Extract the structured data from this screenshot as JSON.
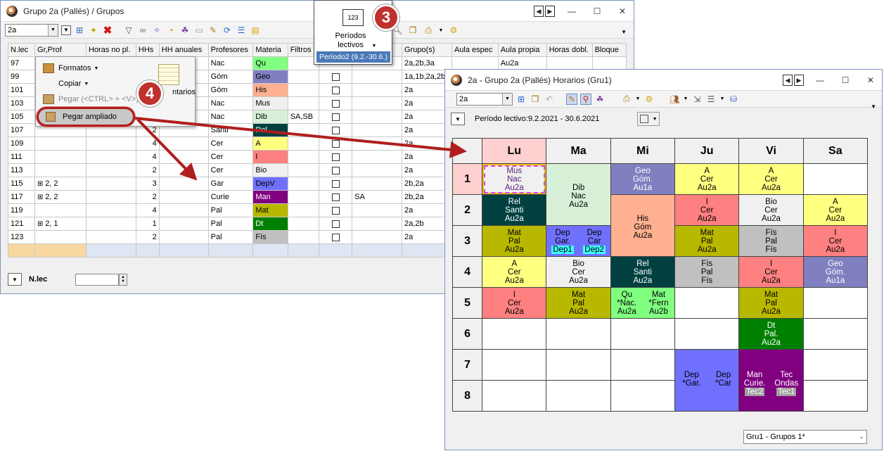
{
  "left_window": {
    "title": "Grupo 2a (Pallés) / Grupos",
    "class_select": "2a",
    "columns": [
      "N.lec",
      "Gr,Prof",
      "Horas no pl.",
      "HHs",
      "HH anuales",
      "Profesores",
      "Materia",
      "Filtros",
      "",
      "",
      "Grupo(s)",
      "Aula espec",
      "Aula propia",
      "Horas dobl.",
      "Bloque"
    ],
    "rows": [
      {
        "nlec": "97",
        "grprof": "",
        "hhs": "",
        "prof": "Nac",
        "mat": "Qu",
        "matcolor": "#80ff80",
        "filtros": "",
        "chk": false,
        "col10": "",
        "grupos": "2a,2b,3a",
        "aulaprop": "Au2a"
      },
      {
        "nlec": "99",
        "grprof": "",
        "hhs": "",
        "prof": "Góm",
        "mat": "Geo",
        "matcolor": "#8080c0",
        "filtros": "",
        "chk": true,
        "col10": "",
        "grupos": "1a,1b,2a,2b",
        "aulaprop": ""
      },
      {
        "nlec": "101",
        "grprof": "",
        "hhs": "",
        "prof": "Góm",
        "mat": "His",
        "matcolor": "#ffb090",
        "filtros": "",
        "chk": true,
        "col10": "",
        "grupos": "2a",
        "aulaprop": ""
      },
      {
        "nlec": "103",
        "grprof": "",
        "hhs": "",
        "prof": "Nac",
        "mat": "Mus",
        "matcolor": "#f0f0f0",
        "filtros": "",
        "chk": true,
        "col10": "",
        "grupos": "2a",
        "aulaprop": ""
      },
      {
        "nlec": "105",
        "grprof": "",
        "hhs": "",
        "prof": "Nac",
        "mat": "Dib",
        "matcolor": "#d8f0d8",
        "filtros": "SA,SB",
        "chk": true,
        "col10": "",
        "grupos": "2a",
        "aulaprop": ""
      },
      {
        "nlec": "107",
        "grprof": "",
        "hhs": "2",
        "prof": "Santi",
        "mat": "Rel",
        "matcolor": "#004040",
        "filtros": "",
        "chk": true,
        "col10": "",
        "grupos": "2a",
        "aulaprop": ""
      },
      {
        "nlec": "109",
        "grprof": "",
        "hhs": "4",
        "prof": "Cer",
        "mat": "A",
        "matcolor": "#ffff80",
        "filtros": "",
        "chk": true,
        "col10": "",
        "grupos": "2a",
        "aulaprop": ""
      },
      {
        "nlec": "111",
        "grprof": "",
        "hhs": "4",
        "prof": "Cer",
        "mat": "I",
        "matcolor": "#ff8080",
        "filtros": "",
        "chk": true,
        "col10": "",
        "grupos": "2a",
        "aulaprop": ""
      },
      {
        "nlec": "113",
        "grprof": "",
        "hhs": "2",
        "prof": "Cer",
        "mat": "Bio",
        "matcolor": "#f0f0f0",
        "filtros": "",
        "chk": true,
        "col10": "",
        "grupos": "2a",
        "aulaprop": ""
      },
      {
        "nlec": "115",
        "grprof": "2, 2",
        "hhs": "3",
        "prof": "Gar",
        "mat": "DepV",
        "matcolor": "#7070ff",
        "filtros": "",
        "chk": true,
        "col10": "",
        "grupos": "2b,2a",
        "aulaprop": ""
      },
      {
        "nlec": "117",
        "grprof": "2, 2",
        "hhs": "2",
        "prof": "Curie",
        "mat": "Man",
        "matcolor": "#800080",
        "filtros": "",
        "chk": true,
        "col10": "SA",
        "grupos": "2b,2a",
        "aulaprop": ""
      },
      {
        "nlec": "119",
        "grprof": "",
        "hhs": "4",
        "prof": "Pal",
        "mat": "Mat",
        "matcolor": "#b8b800",
        "filtros": "",
        "chk": true,
        "col10": "",
        "grupos": "2a",
        "aulaprop": ""
      },
      {
        "nlec": "121",
        "grprof": "2, 1",
        "hhs": "1",
        "prof": "Pal",
        "mat": "Dt",
        "matcolor": "#008000",
        "filtros": "",
        "chk": true,
        "col10": "",
        "grupos": "2a,2b",
        "aulaprop": ""
      },
      {
        "nlec": "123",
        "grprof": "",
        "hhs": "2",
        "prof": "Pal",
        "mat": "Fís",
        "matcolor": "#c0c0c0",
        "filtros": "",
        "chk": true,
        "col10": "",
        "grupos": "2a",
        "aulaprop": ""
      }
    ],
    "bottom_label": "N.lec"
  },
  "periods_popup": {
    "title": "Períodos lectivos",
    "current": "Período2 (9.2.-30.6.)",
    "icon_text": "123"
  },
  "context_menu": {
    "formatos": "Formatos",
    "copiar": "Copiar",
    "pegar": "Pegar  (<CTRL> + <V>)",
    "pegar_ampliado": "Pegar ampliado",
    "comentarios_partial": "ntarios"
  },
  "badges": {
    "three": "3",
    "four": "4"
  },
  "right_window": {
    "title": "2a - Grupo 2a (Pallés)  Horarios  (Gru1)",
    "class_select": "2a",
    "period_label": "Período lectivo:9.2.2021 - 30.6.2021",
    "days": [
      "Lu",
      "Ma",
      "Mi",
      "Ju",
      "Vi",
      "Sa"
    ],
    "hours": [
      "1",
      "2",
      "3",
      "4",
      "5",
      "6",
      "7",
      "8"
    ],
    "cells": {
      "lu1": [
        "Mus",
        "Nac",
        "Au2a"
      ],
      "lu2": [
        "Rel",
        "Santi",
        "Au2a"
      ],
      "lu3": [
        "Mat",
        "Pal",
        "Au2a"
      ],
      "lu4": [
        "A",
        "Cer",
        "Au2a"
      ],
      "lu5": [
        "I",
        "Cer",
        "Au2a"
      ],
      "ma12": [
        "Dib",
        "Nac",
        "Au2a"
      ],
      "ma3a": [
        "Dep",
        "Gar.",
        "Dep1"
      ],
      "ma3b": [
        "Dep",
        "Car",
        "Dep2"
      ],
      "ma4": [
        "Bio",
        "Cer",
        "Au2a"
      ],
      "ma5": [
        "Mat",
        "Pal",
        "Au2a"
      ],
      "mi1": [
        "Geo",
        "Góm.",
        "Au1a"
      ],
      "mi23": [
        "His",
        "Góm",
        "Au2a"
      ],
      "mi4": [
        "Rel",
        "Santi",
        "Au2a"
      ],
      "mi5a": [
        "Qu",
        "*Nac.",
        "Au2a"
      ],
      "mi5b": [
        "Mat",
        "*Fern",
        "Au2b"
      ],
      "ju1": [
        "A",
        "Cer",
        "Au2a"
      ],
      "ju2": [
        "I",
        "Cer",
        "Au2a"
      ],
      "ju3": [
        "Mat",
        "Pal",
        "Au2a"
      ],
      "ju4": [
        "Fís",
        "Pal",
        "Fís"
      ],
      "ju78a": [
        "Dep",
        "*Gar."
      ],
      "ju78b": [
        "Dep",
        "*Car"
      ],
      "vi1": [
        "A",
        "Cer",
        "Au2a"
      ],
      "vi2": [
        "Bio",
        "Cer",
        "Au2a"
      ],
      "vi3": [
        "Fís",
        "Pal",
        "Fís"
      ],
      "vi4": [
        "I",
        "Cer",
        "Au2a"
      ],
      "vi5": [
        "Mat",
        "Pal",
        "Au2a"
      ],
      "vi6": [
        "Dt",
        "Pal.",
        "Au2a"
      ],
      "vi78a": [
        "Man",
        "Curie.",
        "Tec2"
      ],
      "vi78b": [
        "Tec",
        "Ondas",
        "Tec1"
      ],
      "sa2": [
        "A",
        "Cer",
        "Au2a"
      ],
      "sa3": [
        "I",
        "Cer",
        "Au2a"
      ],
      "sa4": [
        "Geo",
        "Góm.",
        "Au1a"
      ]
    },
    "footer_select": "Gru1 - Grupos 1*"
  },
  "colors": {
    "mus": "#f0f0f0",
    "rel": "#004040",
    "mat": "#b8b800",
    "a": "#ffff80",
    "i": "#ff8080",
    "dib": "#d8f0d8",
    "dep": "#7070ff",
    "depbadge": "#40ffff",
    "bio": "#f0f0f0",
    "geo": "#8080c0",
    "his": "#ffb090",
    "qu": "#80ff80",
    "fis": "#c0c0c0",
    "dt": "#008000",
    "man": "#800080",
    "tecbadge": "#a0a0a0",
    "dayhl": "#ffd0d0",
    "arrow": "#b01e1e",
    "badge": "#c0312e"
  }
}
